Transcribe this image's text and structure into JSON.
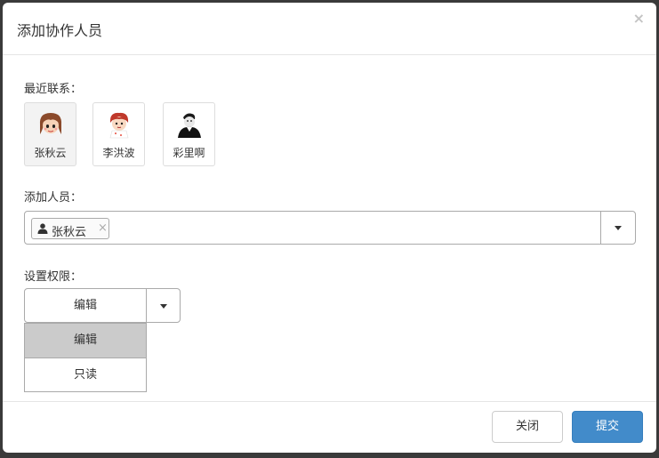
{
  "modal": {
    "title": "添加协作人员",
    "close_glyph": "×"
  },
  "recent_contacts": {
    "label": "最近联系：",
    "items": [
      {
        "name": "张秋云",
        "avatar": "girl-avatar-icon",
        "selected": true
      },
      {
        "name": "李洪波",
        "avatar": "redhead-avatar-icon",
        "selected": false
      },
      {
        "name": "彩里啊",
        "avatar": "dark-avatar-icon",
        "selected": false
      }
    ]
  },
  "add_people": {
    "label": "添加人员：",
    "selected_chips": [
      {
        "name": "张秋云",
        "icon": "user-icon",
        "remove_glyph": "×"
      }
    ]
  },
  "permission": {
    "label": "设置权限：",
    "current_value": "编辑",
    "options": [
      {
        "label": "编辑",
        "active": true
      },
      {
        "label": "只读",
        "active": false
      }
    ]
  },
  "footer": {
    "close_label": "关闭",
    "submit_label": "提交"
  },
  "colors": {
    "primary": "#428bca",
    "overlay": "#3a3a3a",
    "active_option": "#cbcbcb"
  }
}
